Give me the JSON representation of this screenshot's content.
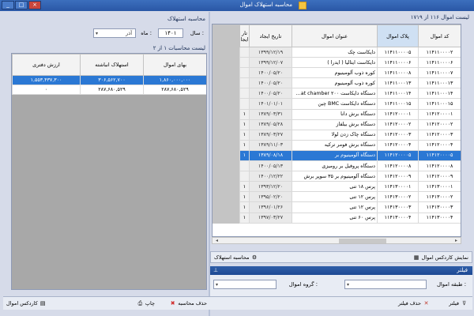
{
  "window": {
    "title": "محاسبه استهلاک اموال",
    "buttons": [
      "_",
      "□",
      "×"
    ]
  },
  "right": {
    "count_label": "لیست اموال ۱۱۶ از ۱۷۱۹",
    "columns": [
      "کد اموال",
      "پلاک اموال",
      "عنوان اموال",
      "تاریخ ایجاد",
      "تار ایجا"
    ],
    "rows": [
      {
        "code": "۱۱۴۱۱۰۰۰۰۲",
        "plate": "۱۱۴۱۱۰۰۰۰۵",
        "name": "دایکاست چک",
        "date": "۱۳۹۹/۱۲/۱۹",
        "extra": ""
      },
      {
        "code": "۱۱۴۱۱۰۰۰۰۶",
        "plate": "۱۱۴۱۱۰۰۰۰۶",
        "name": "دایکاست ایتالیا ( ایدرا )",
        "date": "۱۳۹۹/۱۲/۰۷",
        "extra": ""
      },
      {
        "code": "۱۱۴۱۱۰۰۰۰۷",
        "plate": "۱۱۴۱۱۰۰۰۰۸",
        "name": "کوره ذوب آلومینیوم",
        "date": "۱۴۰۰/۰۵/۲۰",
        "extra": ""
      },
      {
        "code": "۱۱۴۱۱۰۰۰۱۳",
        "plate": "۱۱۴۱۱۰۰۰۱۳",
        "name": "کوره ذوب آلومینیوم",
        "date": "۱۴۰۰/۰۵/۲۰",
        "extra": ""
      },
      {
        "code": "۱۱۴۱۱۰۰۰۱۴",
        "plate": "۱۱۴۱۱۰۰۰۱۴",
        "name": "دستگاه دایکاست ۲۰۰ hat chamber...",
        "date": "۱۴۰۰/۰۵/۲۰",
        "extra": ""
      },
      {
        "code": "۱۱۴۱۱۰۰۰۱۵",
        "plate": "۱۱۴۱۱۰۰۰۱۵",
        "name": "دستگاه دایکاست BMC چین",
        "date": "۱۴۰۱/۰۱/۰۱",
        "extra": ""
      },
      {
        "code": "۱۱۴۱۲۰۰۰۰۱",
        "plate": "۱۱۴۱۲۰۰۰۰۱",
        "name": "دستگاه برش دانا",
        "date": "۱۳۸۹/۰۳/۳۱",
        "extra": "۱"
      },
      {
        "code": "۱۱۴۱۲۰۰۰۰۲",
        "plate": "۱۱۴۱۲۰۰۰۰۲",
        "name": "دستگاه برش بیلفاز",
        "date": "۱۳۸۹/۰۵/۲۸",
        "extra": "۱"
      },
      {
        "code": "۱۱۴۱۲۰۰۰۰۳",
        "plate": "۱۱۴۱۲۰۰۰۰۳",
        "name": "دستگاه چاک زدن لولا",
        "date": "۱۳۸۹/۰۳/۲۷",
        "extra": "۱"
      },
      {
        "code": "۱۱۴۱۲۰۰۰۰۴",
        "plate": "۱۱۴۱۲۰۰۰۰۴",
        "name": "دستگاه برش فومر ترکیه",
        "date": "۱۳۸۹/۱۱/۰۳",
        "extra": "۱"
      },
      {
        "code": "۱۱۴۱۲۰۰۰۰۵",
        "plate": "۱۱۴۱۲۰۰۰۰۵",
        "name": "دستگاه آلومینیوم بر",
        "date": "۱۳۸۹/۰۸/۱۸",
        "extra": "۱"
      },
      {
        "code": "۱۱۴۱۲۰۰۰۰۸",
        "plate": "۱۱۴۱۲۰۰۰۰۸",
        "name": "دستگاه پروفیل بر رومیزی",
        "date": "۱۴۰۰/۰۵/۱۳",
        "extra": ""
      },
      {
        "code": "۱۱۴۱۲۰۰۰۰۹",
        "plate": "۱۱۴۱۲۰۰۰۰۹",
        "name": "دستگاه آلومینیوم بر ۳۵ سوپر برش",
        "date": "۱۴۰۰/۱۲/۲۲",
        "extra": ""
      },
      {
        "code": "۱۱۴۱۳۰۰۰۰۱",
        "plate": "۱۱۴۱۳۰۰۰۰۱",
        "name": "پرس ۱۸ تنی",
        "date": "۱۳۹۳/۱۲/۲۰",
        "extra": "۱"
      },
      {
        "code": "۱۱۴۱۳۰۰۰۰۲",
        "plate": "۱۱۴۱۳۰۰۰۰۲",
        "name": "پرس ۱۲ تنی",
        "date": "۱۳۹۵/۰۲/۲۰",
        "extra": "۱"
      },
      {
        "code": "۱۱۴۱۳۰۰۰۰۳",
        "plate": "۱۱۴۱۳۰۰۰۰۳",
        "name": "پرس ۱۲ تنی",
        "date": "۱۳۹۶/۰۱/۲۶",
        "extra": "۱"
      },
      {
        "code": "۱۱۴۱۳۰۰۰۰۴",
        "plate": "۱۱۴۱۳۰۰۰۰۴",
        "name": "پرس ۶۰ تنی",
        "date": "۱۳۹۷/۰۳/۲۷",
        "extra": "۱"
      }
    ],
    "selected_row": 10,
    "kardex_button": "نمایش کاردکس اموال",
    "calc_button": "محاسبه استهلاک",
    "filter_title": "فیلتر",
    "filter": {
      "class_label": "طبقه اموال :",
      "group_label": "گروه اموال :",
      "class_value": "",
      "group_value": ""
    },
    "filter_button": "فیلتر",
    "clear_filter_button": "حذف فیلتر"
  },
  "left": {
    "section_title": "محاسبه استهلاک",
    "year_label": "سال :",
    "year_value": "۱۴۰۱",
    "month_label": "ماه :",
    "month_value": "آذر",
    "list_label": "لیست محاسبات ۱ از ۲",
    "columns": [
      "بهای اموال",
      "استهلاک انباشته",
      "ارزش دفتری"
    ],
    "rows": [
      {
        "price": "۱,۸۶۰,۰۰۰,۰۰۰",
        "accum": "۳۰۶,۵۶۲,۷۰۰",
        "book": "۱,۵۵۳,۴۳۷,۳۰۰"
      },
      {
        "price": "۲۸۷,۶۸۰,۵۲۹",
        "accum": "۲۸۷,۶۸۰,۵۲۹",
        "book": "۰"
      }
    ],
    "selected_row": 0,
    "delete_button": "حذف محاسبه",
    "print_button": "چاپ",
    "kardex_button": "کاردکس اموال"
  },
  "colors": {
    "title_bar": "#2a57a6",
    "selection": "#2b78d4",
    "panel_bg": "#d6dbe9"
  },
  "icons": [
    "app-icon",
    "dropdown-icon",
    "settings-icon",
    "grid-icon",
    "pin-icon",
    "filter-icon",
    "clear-filter-icon",
    "delete-icon",
    "print-icon",
    "kardex-icon"
  ]
}
